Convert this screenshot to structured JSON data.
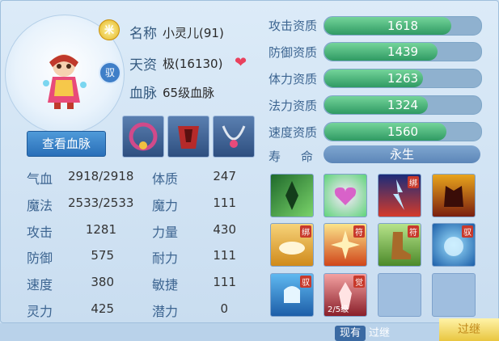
{
  "pet": {
    "name_label": "名称",
    "name_value": "小灵儿(91)",
    "aptitude_label": "天资",
    "aptitude_value": "极(16130)",
    "bloodline_label": "血脉",
    "bloodline_value": "65级血脉",
    "view_bloodline_button": "查看血脉",
    "medal_icon_text": "米",
    "yu_badge_text": "驭"
  },
  "stats": [
    {
      "label": "气血",
      "value": "2918/2918",
      "label2": "体质",
      "value2": "247"
    },
    {
      "label": "魔法",
      "value": "2533/2533",
      "label2": "魔力",
      "value2": "111"
    },
    {
      "label": "攻击",
      "value": "1281",
      "label2": "力量",
      "value2": "430"
    },
    {
      "label": "防御",
      "value": "575",
      "label2": "耐力",
      "value2": "111"
    },
    {
      "label": "速度",
      "value": "380",
      "label2": "敏捷",
      "value2": "111"
    },
    {
      "label": "灵力",
      "value": "425",
      "label2": "潜力",
      "value2": "0"
    }
  ],
  "aptitudes": [
    {
      "label": "攻击资质",
      "value": "1618",
      "fill": 0.81
    },
    {
      "label": "防御资质",
      "value": "1439",
      "fill": 0.72
    },
    {
      "label": "体力资质",
      "value": "1263",
      "fill": 0.63
    },
    {
      "label": "法力资质",
      "value": "1324",
      "fill": 0.66
    },
    {
      "label": "速度资质",
      "value": "1560",
      "fill": 0.78
    }
  ],
  "life": {
    "label1": "寿",
    "label2": "命",
    "value": "永生"
  },
  "skill_tags": {
    "bind": "绑",
    "fu": "符",
    "yu": "驭",
    "jue": "觉",
    "level": "2/5级"
  },
  "tabs": {
    "now": "现有",
    "past": "过继"
  },
  "corner_button": "过继",
  "colors": {
    "bar_fill": "#2f9a63",
    "accent": "#3b6aa3"
  }
}
